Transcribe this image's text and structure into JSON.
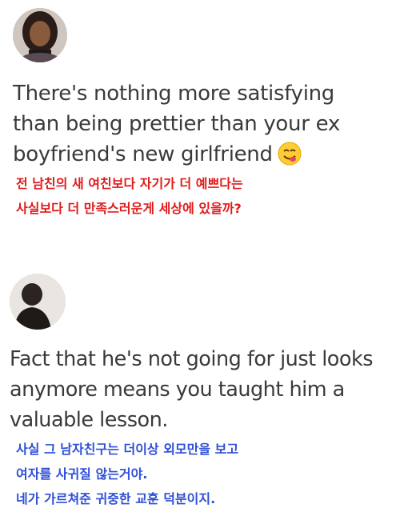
{
  "posts": [
    {
      "avatar": {
        "icon": "user-avatar-woman"
      },
      "tweet_lines": [
        "There's nothing more satisfying",
        "than being prettier than your ex",
        "boyfriend's new girlfriend"
      ],
      "emoji": "yum-face-emoji",
      "translation_lines": [
        "전 남친의 새 여친보다 자기가 더 예쁘다는",
        "사실보다 더 만족스러운게 세상에 있을까?"
      ],
      "translation_color": "#e01a1a"
    },
    {
      "avatar": {
        "icon": "user-avatar-silhouette"
      },
      "tweet_lines": [
        "Fact that he's not going for just looks",
        "anymore means you taught him a",
        "valuable lesson."
      ],
      "translation_lines": [
        "사실 그 남자친구는 더이상 외모만을 보고",
        "여자를 사귀질 않는거야.",
        "네가 가르쳐준 귀중한 교훈 덕분이지."
      ],
      "translation_color": "#2f4fd6"
    }
  ]
}
